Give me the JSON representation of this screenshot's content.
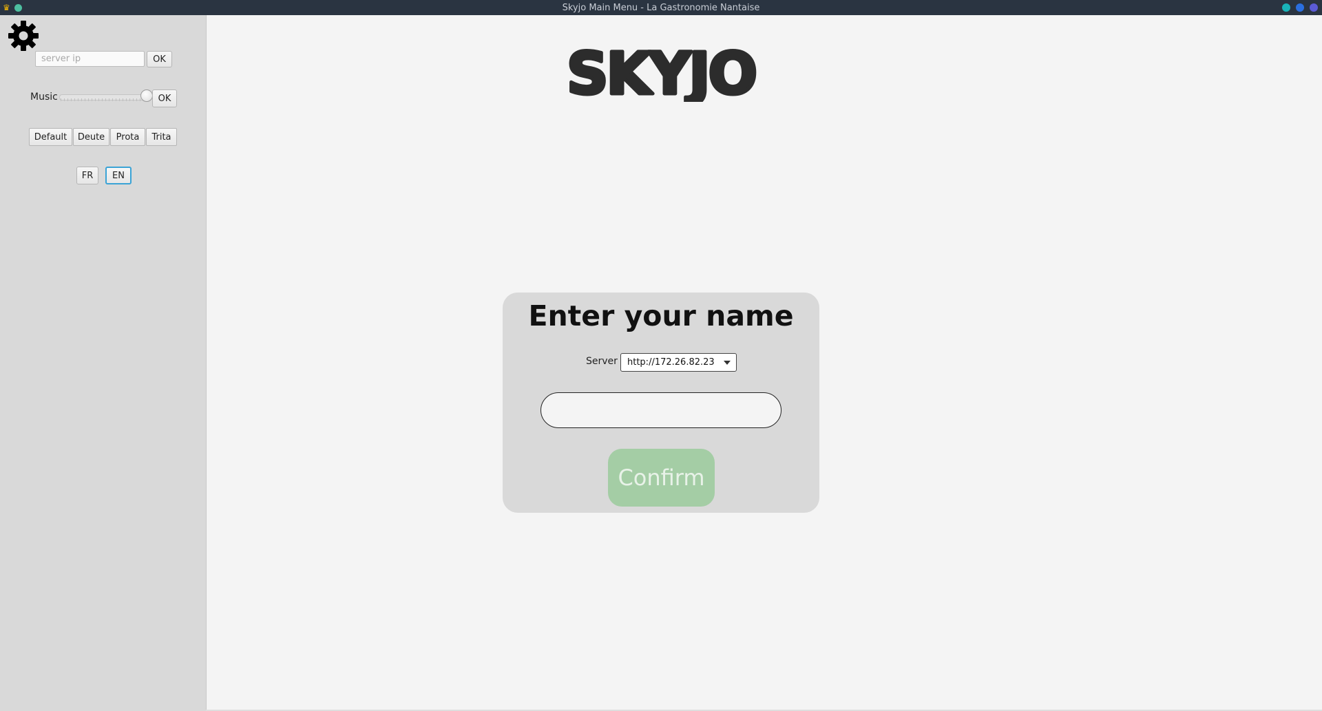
{
  "window": {
    "title": "Skyjo Main Menu - La Gastronomie Nantaise",
    "controls": [
      "minimize-icon",
      "maximize-icon",
      "close-icon"
    ],
    "control_colors": [
      "#19b3b8",
      "#2a6fe0",
      "#5b5bd6"
    ]
  },
  "sidebar": {
    "settings_icon": "gear-icon",
    "server_ip": {
      "placeholder": "server ip",
      "value": ""
    },
    "server_ok_label": "OK",
    "music": {
      "label": "Music",
      "volume_fraction": 1.0,
      "ok_label": "OK"
    },
    "color_modes": [
      {
        "label": "Default"
      },
      {
        "label": "Deute"
      },
      {
        "label": "Prota"
      },
      {
        "label": "Trita"
      }
    ],
    "languages": [
      {
        "label": "FR",
        "selected": false
      },
      {
        "label": "EN",
        "selected": true
      }
    ]
  },
  "main": {
    "logo_text": "SKYJO",
    "card": {
      "title": "Enter your name",
      "server_label": "Server",
      "server_selected": "http://172.26.82.23",
      "name_value": "",
      "confirm_label": "Confirm"
    }
  },
  "colors": {
    "confirm_bg": "#a4cda5",
    "card_bg": "#d9d9d9",
    "selected_lang_border": "#3aa3d6"
  }
}
